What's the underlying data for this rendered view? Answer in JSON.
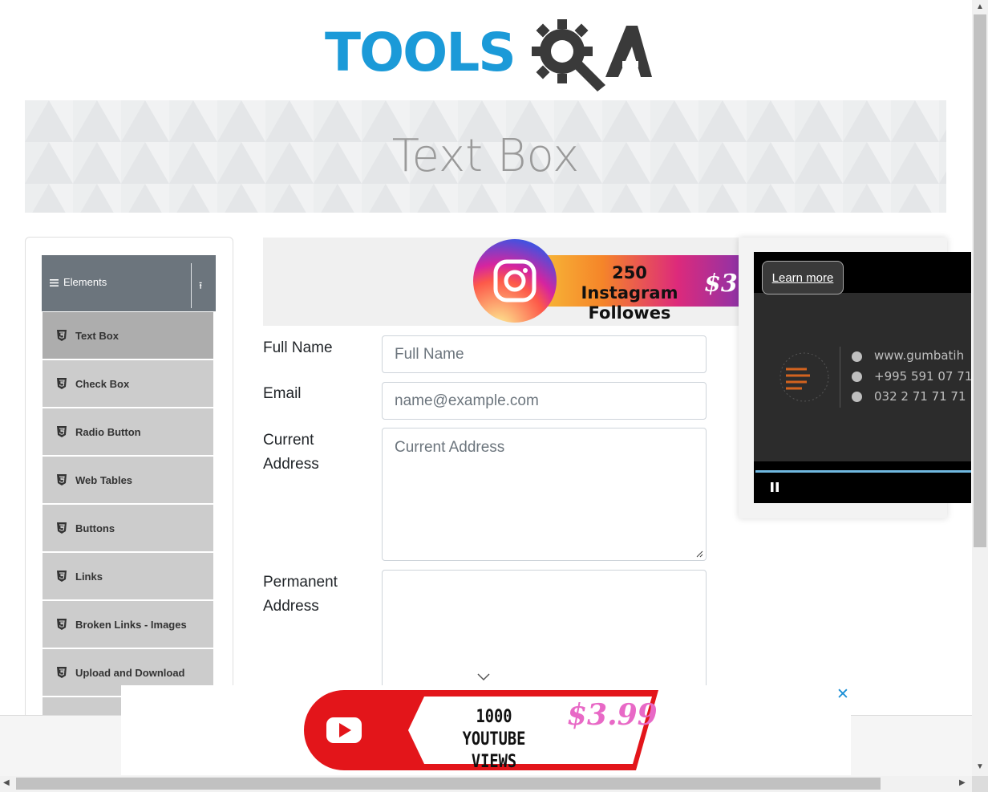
{
  "logo": {
    "text": "TOOLS",
    "accent": "QA",
    "colors": {
      "tools": "#1b9ad8",
      "qa": "#3a3a3a"
    }
  },
  "banner": {
    "title": "Text Box"
  },
  "sidebar": {
    "group_label": "Elements",
    "items": [
      {
        "label": "Text Box",
        "active": true
      },
      {
        "label": "Check Box"
      },
      {
        "label": "Radio Button"
      },
      {
        "label": "Web Tables"
      },
      {
        "label": "Buttons"
      },
      {
        "label": "Links"
      },
      {
        "label": "Broken Links - Images"
      },
      {
        "label": "Upload and Download"
      }
    ]
  },
  "ad_top": {
    "text_line1": "250 Instagram",
    "text_line2": "Followes",
    "price": "$3."
  },
  "form": {
    "full_name": {
      "label": "Full Name",
      "placeholder": "Full Name"
    },
    "email": {
      "label": "Email",
      "placeholder": "name@example.com"
    },
    "current_address": {
      "label_line1": "Current",
      "label_line2": "Address",
      "placeholder": "Current Address"
    },
    "permanent_address": {
      "label_line1": "Permanent",
      "label_line2": "Address",
      "placeholder": ""
    }
  },
  "video_ad": {
    "learn_more": "Learn more",
    "website": "www.gumbatih",
    "phone1": "+995 591 07 71",
    "phone2": "032 2 71 71 71"
  },
  "ad_bottom": {
    "close": "✕",
    "line1": "1000",
    "line2": "YOUTUBE VIEWS",
    "price": "$3.99"
  }
}
